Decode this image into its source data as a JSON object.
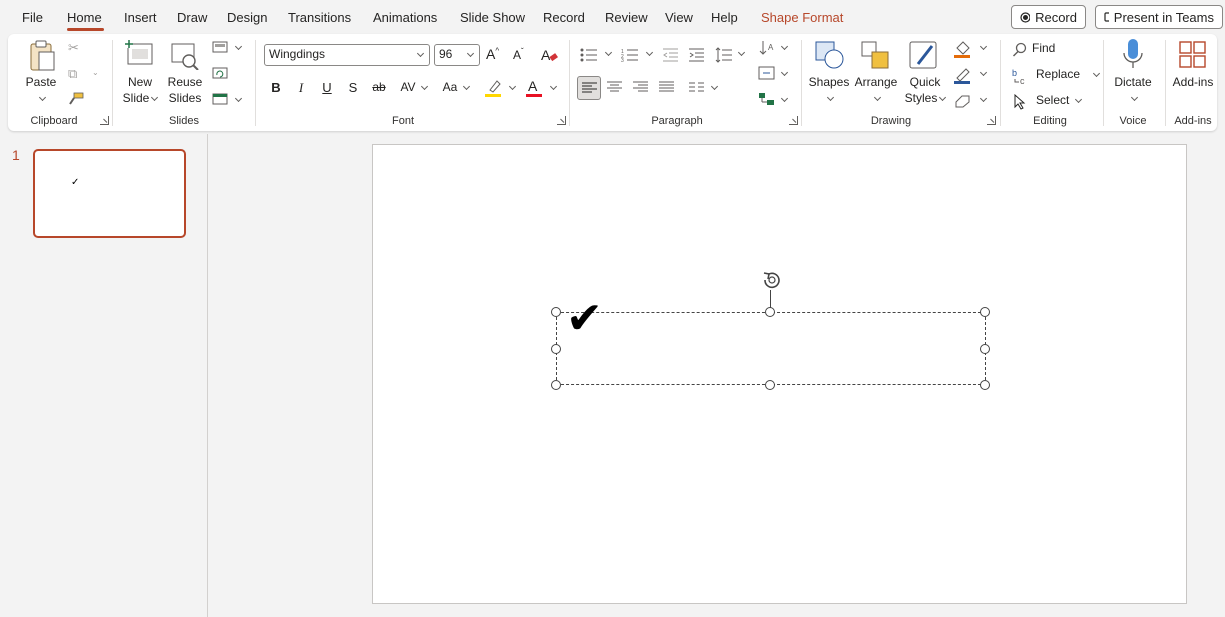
{
  "menu": {
    "file": "File",
    "home": "Home",
    "insert": "Insert",
    "draw": "Draw",
    "design": "Design",
    "transitions": "Transitions",
    "animations": "Animations",
    "slideshow": "Slide Show",
    "record": "Record",
    "review": "Review",
    "view": "View",
    "help": "Help",
    "shape_format": "Shape Format"
  },
  "topbar": {
    "record_button": "Record",
    "present_teams": "Present in Teams"
  },
  "clipboard": {
    "paste": "Paste",
    "group": "Clipboard"
  },
  "slides": {
    "new_slide_1": "New",
    "new_slide_2": "Slide",
    "reuse_1": "Reuse",
    "reuse_2": "Slides",
    "group": "Slides"
  },
  "font": {
    "name": "Wingdings",
    "size": "96",
    "group": "Font"
  },
  "paragraph": {
    "group": "Paragraph"
  },
  "drawing": {
    "shapes": "Shapes",
    "arrange": "Arrange",
    "quick_1": "Quick",
    "quick_2": "Styles",
    "group": "Drawing"
  },
  "editing": {
    "find": "Find",
    "replace": "Replace",
    "select": "Select",
    "group": "Editing"
  },
  "voice": {
    "dictate": "Dictate",
    "group": "Voice"
  },
  "addins": {
    "label": "Add-ins",
    "group": "Add-ins"
  },
  "thumbnail": {
    "number": "1",
    "glyph": "✓"
  },
  "slide_content": {
    "glyph": "✔"
  },
  "colors": {
    "accent": "#b7472a",
    "highlight": "#ffd700",
    "font_color": "#e81123",
    "fill_color": "#e46c0a",
    "outline_color": "#2b579a"
  }
}
